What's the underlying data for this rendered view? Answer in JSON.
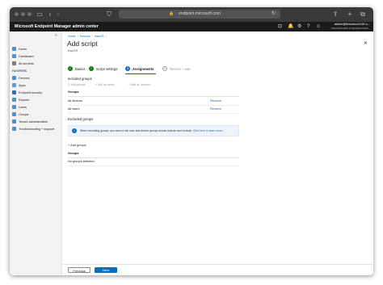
{
  "browser": {
    "url": "endpoint.microsoft.com",
    "lock_icon": "lock-icon",
    "buttons": [
      "sidebar-toggle-icon",
      "back-icon",
      "forward-icon",
      "shield-icon",
      "reload-icon",
      "share-icon",
      "new-tab-icon",
      "tabs-icon"
    ]
  },
  "header": {
    "title": "Microsoft Endpoint Manager admin center",
    "account_name": "admin@thecrisco2020.o...",
    "account_org": "THECRISCOENT (THECRISCO2020..."
  },
  "sidebar": {
    "items": [
      {
        "label": "Home",
        "icon": "home-icon",
        "color": "#4a90d9"
      },
      {
        "label": "Dashboard",
        "icon": "dashboard-icon",
        "color": "#4a90d9"
      },
      {
        "label": "All services",
        "icon": "grid-icon",
        "color": "#7a7a7a"
      },
      {
        "label": "FAVORITES",
        "icon": "",
        "color": ""
      },
      {
        "label": "Devices",
        "icon": "devices-icon",
        "color": "#4a90d9"
      },
      {
        "label": "Apps",
        "icon": "apps-icon",
        "color": "#5b9bd5"
      },
      {
        "label": "Endpoint security",
        "icon": "shield-icon",
        "color": "#2e6fb7"
      },
      {
        "label": "Reports",
        "icon": "reports-icon",
        "color": "#4a90d9"
      },
      {
        "label": "Users",
        "icon": "user-icon",
        "color": "#4a90d9"
      },
      {
        "label": "Groups",
        "icon": "groups-icon",
        "color": "#4a90d9"
      },
      {
        "label": "Tenant administration",
        "icon": "tenant-icon",
        "color": "#4a90d9"
      },
      {
        "label": "Troubleshooting + support",
        "icon": "wrench-icon",
        "color": "#4a90d9"
      }
    ]
  },
  "breadcrumb": [
    "Home",
    "Devices",
    "macOS"
  ],
  "page": {
    "title": "Add script",
    "subtitle": "macOS"
  },
  "steps": [
    {
      "num": "✓",
      "label": "Basics",
      "state": "done"
    },
    {
      "num": "✓",
      "label": "Script settings",
      "state": "done"
    },
    {
      "num": "3",
      "label": "Assignments",
      "state": "current"
    },
    {
      "num": "4",
      "label": "Review + add",
      "state": "todo"
    }
  ],
  "included": {
    "heading": "Included groups",
    "actions": [
      "Add groups",
      "Add all users",
      "Add all devices"
    ],
    "column": "Groups",
    "rows": [
      {
        "group": "All devices",
        "action": "Remove"
      },
      {
        "group": "All users",
        "action": "Remove"
      }
    ]
  },
  "excluded": {
    "heading": "Excluded groups",
    "info_text": "When excluding groups, you cannot mix user and device groups across include and exclude.",
    "info_link": "Click here to learn more.",
    "add_label": "Add groups",
    "column": "Groups",
    "empty_text": "No groups selected"
  },
  "footer": {
    "previous": "Previous",
    "next": "Next"
  }
}
